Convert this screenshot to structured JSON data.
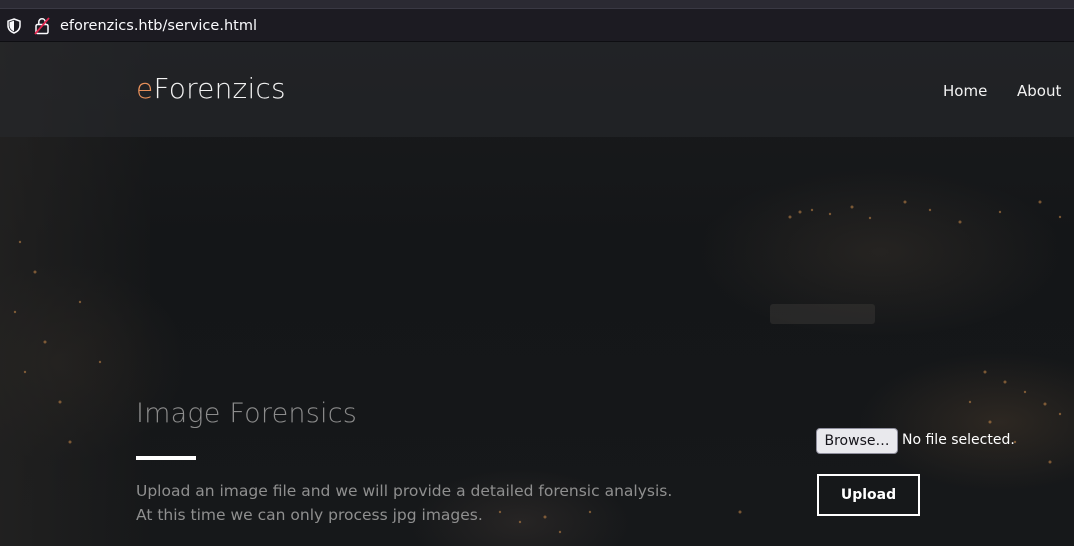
{
  "browser": {
    "url": "eforenzics.htb/service.html",
    "icons": [
      "shield-icon",
      "lock-icon"
    ]
  },
  "navbar": {
    "brand_accent": "e",
    "brand_rest": "Forenzics",
    "links": [
      "Home",
      "About"
    ]
  },
  "main": {
    "heading": "Image Forensics",
    "description_lines": [
      "Upload an image file and we will provide a detailed forensic analysis.",
      "At this time we can only process jpg images."
    ]
  },
  "upload_form": {
    "browse_label": "Browse…",
    "file_status": "No file selected.",
    "upload_label": "Upload"
  },
  "colors": {
    "brand_accent": "#e8905a",
    "background": "#141517"
  }
}
